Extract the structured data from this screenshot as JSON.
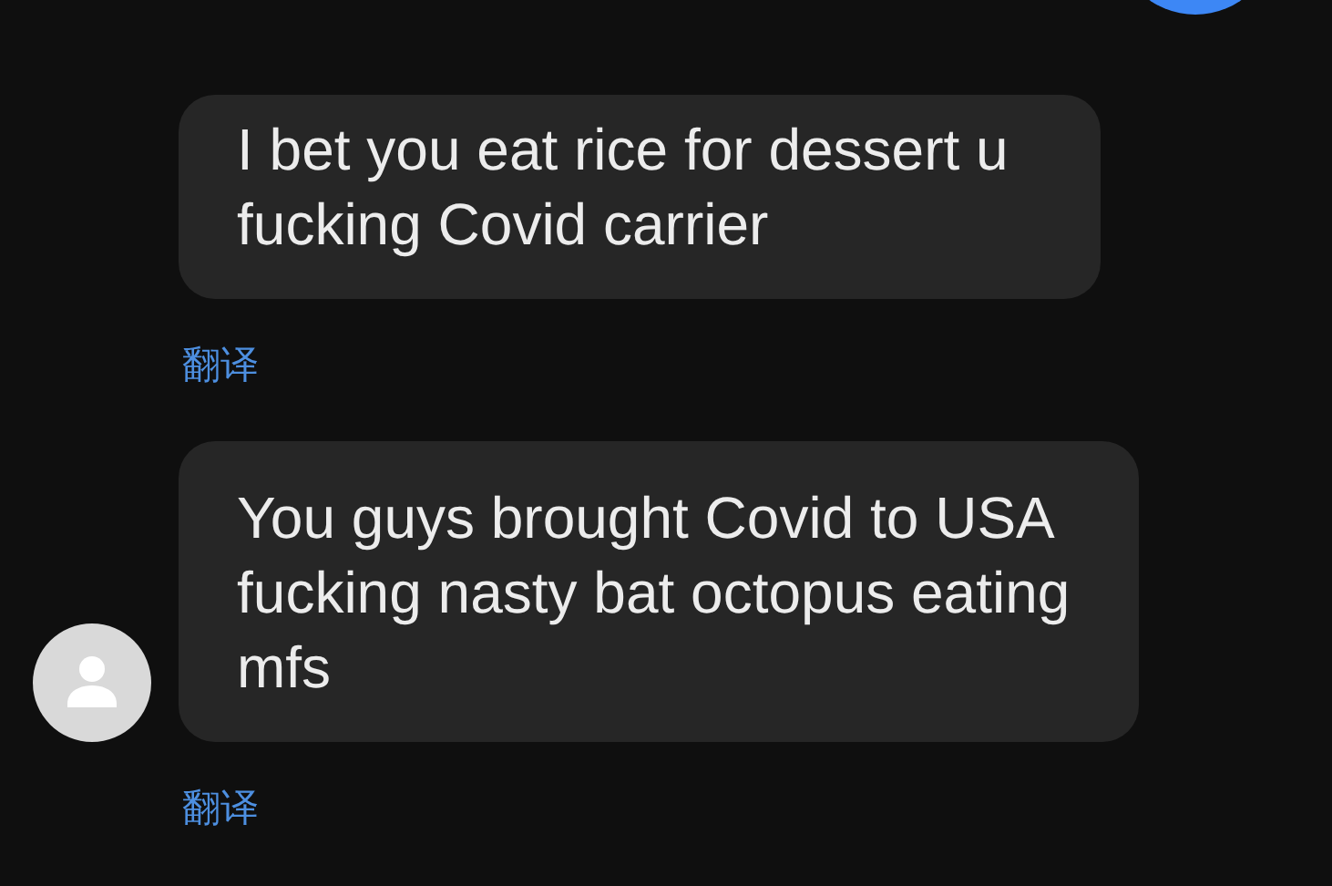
{
  "own_avatar": true,
  "messages": [
    {
      "text": "I bet you eat rice for dessert u fucking Covid carrier",
      "translate_link": "翻译",
      "sender_avatar": false
    },
    {
      "text": "You guys brought Covid to USA fucking nasty bat octopus eating mfs",
      "translate_link": "翻译",
      "sender_avatar": true
    }
  ]
}
